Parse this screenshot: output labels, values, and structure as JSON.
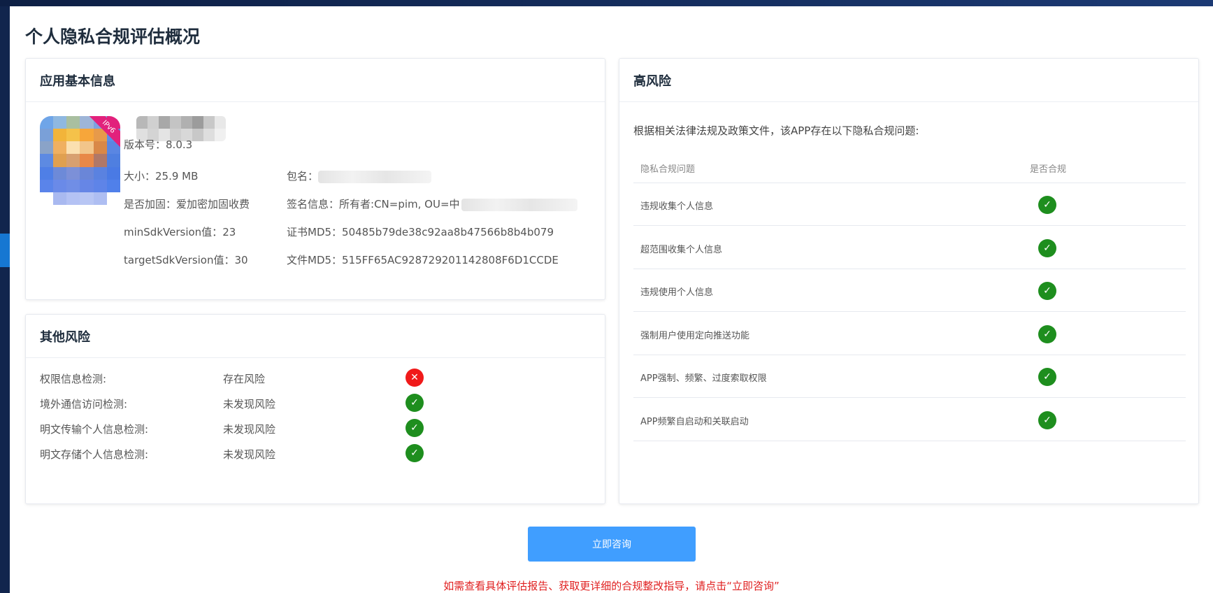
{
  "page": {
    "title": "个人隐私合规评估概况"
  },
  "app_info": {
    "header": "应用基本信息",
    "version_label": "版本号：",
    "version_value": "8.0.3",
    "size_label": "大小：",
    "size_value": "25.9 MB",
    "package_label": "包名：",
    "hardened_label": "是否加固：",
    "hardened_value": "爱加密加固收费",
    "signature_label": "签名信息：",
    "signature_value": "所有者:CN=pim, OU=中",
    "min_sdk_label": "minSdkVersion值：",
    "min_sdk_value": "23",
    "cert_md5_label": "证书MD5：",
    "cert_md5_value": "50485b79de38c92aa8b47566b8b4b079",
    "target_sdk_label": "targetSdkVersion值：",
    "target_sdk_value": "30",
    "file_md5_label": "文件MD5：",
    "file_md5_value": "515FF65AC928729201142808F6D1CCDE",
    "icon_ribbon_text": "IPv6"
  },
  "other_risk": {
    "header": "其他风险",
    "items": [
      {
        "label": "权限信息检测:",
        "value": "存在风险",
        "status": "risk"
      },
      {
        "label": "境外通信访问检测:",
        "value": "未发现风险",
        "status": "ok"
      },
      {
        "label": "明文传输个人信息检测:",
        "value": "未发现风险",
        "status": "ok"
      },
      {
        "label": "明文存储个人信息检测:",
        "value": "未发现风险",
        "status": "ok"
      }
    ]
  },
  "high_risk": {
    "header": "高风险",
    "description": "根据相关法律法规及政策文件，该APP存在以下隐私合规问题:",
    "columns": [
      "隐私合规问题",
      "是否合规"
    ],
    "rows": [
      {
        "issue": "违规收集个人信息",
        "status": "ok"
      },
      {
        "issue": "超范围收集个人信息",
        "status": "ok"
      },
      {
        "issue": "违规使用个人信息",
        "status": "ok"
      },
      {
        "issue": "强制用户使用定向推送功能",
        "status": "ok"
      },
      {
        "issue": "APP强制、频繁、过度索取权限",
        "status": "ok"
      },
      {
        "issue": "APP频繁自启动和关联启动",
        "status": "ok"
      }
    ]
  },
  "footer": {
    "consult_button": "立即咨询",
    "hint": "如需查看具体评估报告、获取更详细的合规整改指导，请点击“立即咨询”"
  },
  "colors": {
    "ok": "#1e8e1e",
    "risk": "#f01a1a",
    "accent": "#409eff",
    "hint": "#e02020"
  },
  "icons": {
    "ok": "check-circle-icon",
    "risk": "x-circle-icon"
  }
}
